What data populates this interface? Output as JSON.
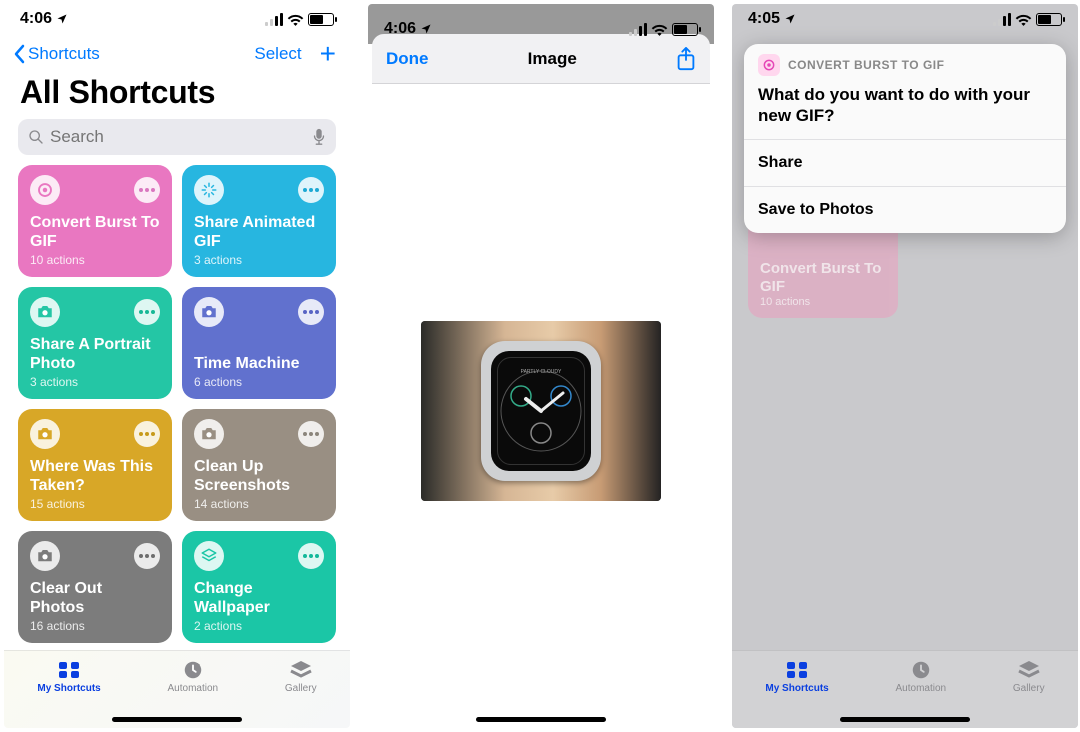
{
  "screen1": {
    "status_time": "4:06",
    "back_label": "Shortcuts",
    "select_label": "Select",
    "page_title": "All Shortcuts",
    "search_placeholder": "Search",
    "tiles": [
      {
        "title": "Convert Burst To GIF",
        "sub": "10 actions",
        "color": "#e977c1",
        "icon": "target"
      },
      {
        "title": "Share Animated GIF",
        "sub": "3 actions",
        "color": "#27b6e0",
        "icon": "sparkle"
      },
      {
        "title": "Share A Portrait Photo",
        "sub": "3 actions",
        "color": "#24c6a5",
        "icon": "camera"
      },
      {
        "title": "Time Machine",
        "sub": "6 actions",
        "color": "#6171ce",
        "icon": "camera"
      },
      {
        "title": "Where Was This Taken?",
        "sub": "15 actions",
        "color": "#d8a727",
        "icon": "camera"
      },
      {
        "title": "Clean Up Screenshots",
        "sub": "14 actions",
        "color": "#998f83",
        "icon": "camera"
      },
      {
        "title": "Clear Out Photos",
        "sub": "16 actions",
        "color": "#7c7c7c",
        "icon": "camera"
      },
      {
        "title": "Change Wallpaper",
        "sub": "2 actions",
        "color": "#1bc6a6",
        "icon": "layers"
      }
    ],
    "tabs": {
      "my": "My Shortcuts",
      "auto": "Automation",
      "gallery": "Gallery"
    }
  },
  "screen2": {
    "status_time": "4:06",
    "done_label": "Done",
    "sheet_title": "Image"
  },
  "screen3": {
    "status_time": "4:05",
    "card_title": "CONVERT BURST TO GIF",
    "question": "What do you want to do with your new GIF?",
    "option_share": "Share",
    "option_save": "Save to Photos",
    "ghost_title": "Convert Burst To GIF",
    "ghost_sub": "10 actions",
    "tabs": {
      "my": "My Shortcuts",
      "auto": "Automation",
      "gallery": "Gallery"
    }
  }
}
